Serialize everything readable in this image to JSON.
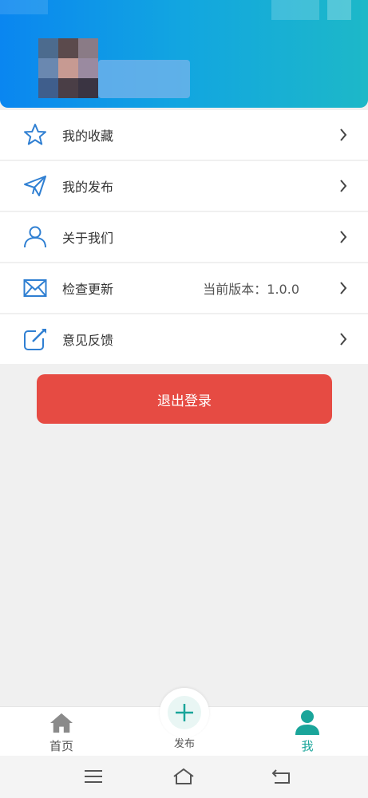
{
  "header": {
    "username": ""
  },
  "menu": {
    "items": [
      {
        "label": "我的收藏",
        "icon": "star-icon",
        "extra": ""
      },
      {
        "label": "我的发布",
        "icon": "paper-plane-icon",
        "extra": ""
      },
      {
        "label": "关于我们",
        "icon": "user-icon",
        "extra": ""
      },
      {
        "label": "检查更新",
        "icon": "envelope-icon",
        "extra": "当前版本：1.0.0"
      },
      {
        "label": "意见反馈",
        "icon": "edit-icon",
        "extra": ""
      }
    ]
  },
  "logout": {
    "label": "退出登录"
  },
  "tabbar": {
    "home_label": "首页",
    "publish_label": "发布",
    "me_label": "我",
    "active": "我"
  },
  "colors": {
    "accent": "#1aa59a",
    "icon_blue": "#2f7fd2",
    "logout_red": "#e64b43",
    "header_start": "#0a86f0",
    "header_end": "#1db8c8"
  }
}
